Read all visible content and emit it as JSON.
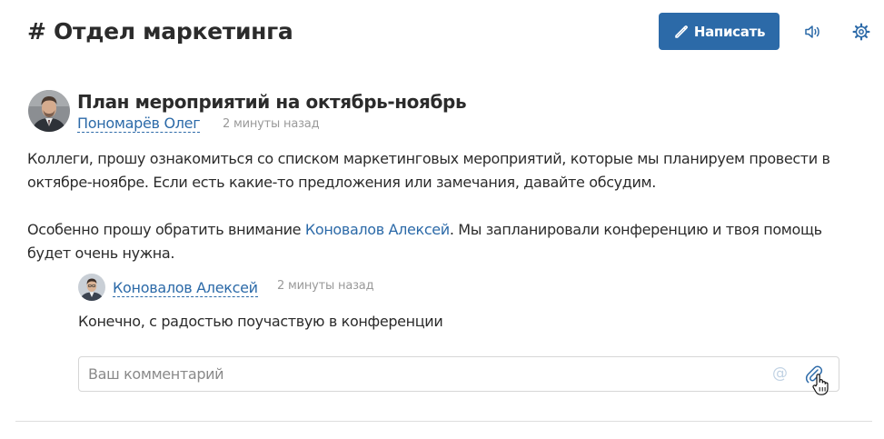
{
  "header": {
    "channel_title": "# Отдел маркетинга",
    "write_button_label": "Написать",
    "accent_color": "#2c6aa8"
  },
  "post": {
    "title": "План мероприятий на октябрь-ноябрь",
    "author": "Пономарёв Олег",
    "time": "2 минуты назад",
    "paragraph1": "Коллеги, прошу ознакомиться со списком маркетинговых мероприятий, которые мы планируем провести в октябре-ноябре. Если есть какие-то предложения или замечания, давайте обсудим.",
    "paragraph2_before": "Особенно прошу обратить внимание ",
    "paragraph2_mention": "Коновалов Алексей",
    "paragraph2_after": ". Мы запланировали конференцию и твоя помощь будет очень нужна."
  },
  "comment": {
    "author": "Коновалов Алексей",
    "time": "2 минуты назад",
    "text": "Конечно, с радостью поучаствую в конференции"
  },
  "comment_input": {
    "placeholder": "Ваш комментарий",
    "value": ""
  },
  "icons": {
    "write": "pencil-icon",
    "sound": "speaker-icon",
    "settings": "gear-icon",
    "mention": "at-icon",
    "attach": "paperclip-icon"
  }
}
